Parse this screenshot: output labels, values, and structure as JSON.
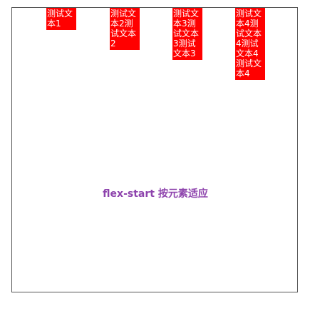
{
  "items": [
    {
      "label": "测试文本1"
    },
    {
      "label": "测试文本2测试文本2"
    },
    {
      "label": "测试文本3测试文本3测试文本3"
    },
    {
      "label": "测试文本4测试文本4测试文本4测试文本4"
    }
  ],
  "caption": "flex-start 按元素适应",
  "colors": {
    "item_bg": "#ff0000",
    "item_text": "#ffffff",
    "caption_text": "#8e44ad",
    "container_border": "#555555"
  }
}
